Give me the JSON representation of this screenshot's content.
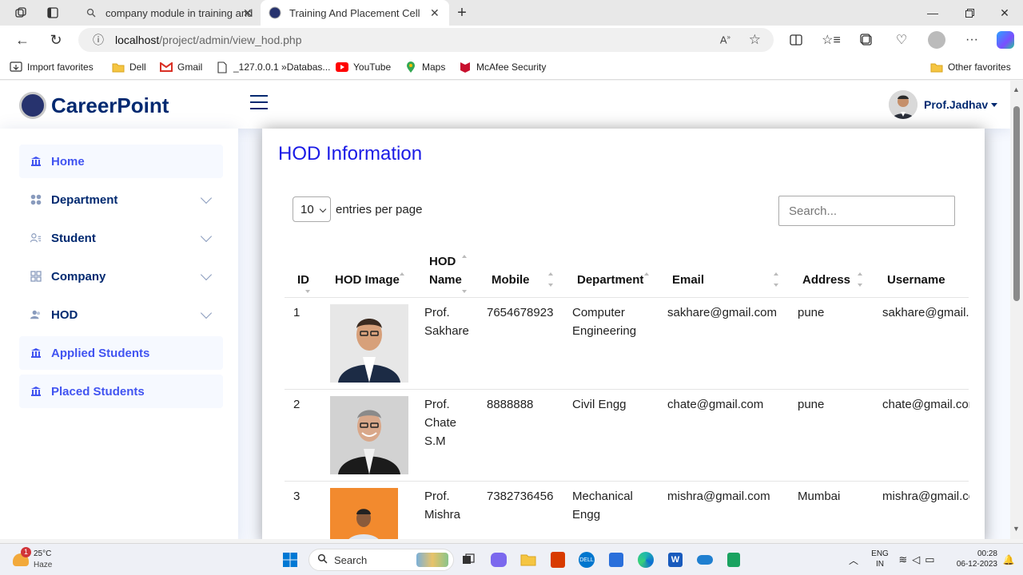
{
  "browser": {
    "tabs": [
      {
        "title": "company module in training and"
      },
      {
        "title": "Training And Placement Cell"
      }
    ],
    "url_host": "localhost",
    "url_path": "/project/admin/view_hod.php",
    "favorites": [
      {
        "label": "Import favorites",
        "icon": "import-icon"
      },
      {
        "label": "Dell",
        "icon": "folder-icon"
      },
      {
        "label": "Gmail",
        "icon": "gmail-icon"
      },
      {
        "label": "_127.0.0.1 »Databas...",
        "icon": "page-icon"
      },
      {
        "label": "YouTube",
        "icon": "youtube-icon"
      },
      {
        "label": "Maps",
        "icon": "maps-icon"
      },
      {
        "label": "McAfee Security",
        "icon": "mcafee-icon"
      }
    ],
    "other_favorites": "Other favorites"
  },
  "app": {
    "brand": "CareerPoint",
    "user": "Prof.Jadhav"
  },
  "sidebar": {
    "items": [
      {
        "label": "Home",
        "icon": "bank-icon"
      },
      {
        "label": "Department",
        "icon": "grid-circles-icon"
      },
      {
        "label": "Student",
        "icon": "person-list-icon"
      },
      {
        "label": "Company",
        "icon": "building-grid-icon"
      },
      {
        "label": "HOD",
        "icon": "people-icon"
      },
      {
        "label": "Applied Students",
        "icon": "bank-icon"
      },
      {
        "label": "Placed Students",
        "icon": "bank-icon"
      }
    ]
  },
  "main": {
    "title": "HOD Information",
    "entries_value": "10",
    "entries_label": "entries per page",
    "search_placeholder": "Search...",
    "columns": [
      "ID",
      "HOD Image",
      "HOD\nName",
      "Mobile",
      "Department",
      "Email",
      "Address",
      "Username"
    ],
    "rows": [
      {
        "id": "1",
        "name": "Prof.\nSakhare",
        "mobile": "7654678923",
        "department": "Computer\nEngineering",
        "email": "sakhare@gmail.com",
        "address": "pune",
        "username": "sakhare@gmail.com"
      },
      {
        "id": "2",
        "name": "Prof.\nChate\nS.M",
        "mobile": "8888888",
        "department": "Civil Engg",
        "email": "chate@gmail.com",
        "address": "pune",
        "username": "chate@gmail.com"
      },
      {
        "id": "3",
        "name": "Prof.\nMishra",
        "mobile": "7382736456",
        "department": "Mechanical\nEngg",
        "email": "mishra@gmail.com",
        "address": "Mumbai",
        "username": "mishra@gmail.com"
      }
    ]
  },
  "taskbar": {
    "weather_temp": "25°C",
    "weather_desc": "Haze",
    "weather_badge": "1",
    "search_label": "Search",
    "lang_top": "ENG",
    "lang_bottom": "IN",
    "time": "00:28",
    "date": "06-12-2023"
  },
  "colors": {
    "brand_navy": "#012970",
    "title_blue": "#1a1ae6",
    "active_blue": "#4154f1"
  }
}
